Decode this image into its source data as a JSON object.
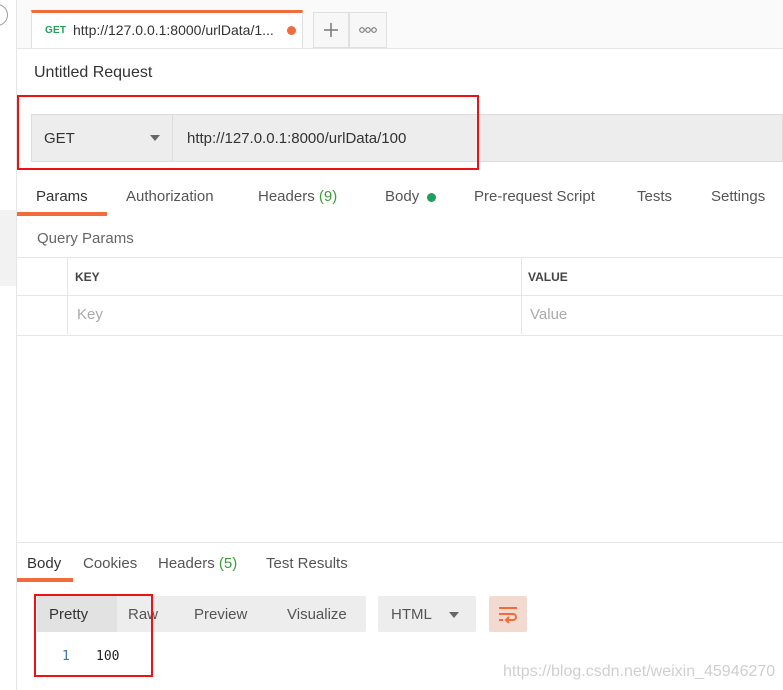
{
  "tab": {
    "method": "GET",
    "title": "http://127.0.0.1:8000/urlData/1...",
    "new_tab_symbol": "+",
    "more_symbol": "◦◦◦"
  },
  "request": {
    "title": "Untitled Request",
    "method": "GET",
    "url": "http://127.0.0.1:8000/urlData/100"
  },
  "request_tabs": [
    {
      "label": "Params"
    },
    {
      "label": "Authorization"
    },
    {
      "label": "Headers",
      "count": "(9)"
    },
    {
      "label": "Body"
    },
    {
      "label": "Pre-request Script"
    },
    {
      "label": "Tests"
    },
    {
      "label": "Settings"
    }
  ],
  "query_params": {
    "title": "Query Params",
    "key_header": "KEY",
    "value_header": "VALUE",
    "key_placeholder": "Key",
    "value_placeholder": "Value"
  },
  "response_tabs": [
    {
      "label": "Body"
    },
    {
      "label": "Cookies"
    },
    {
      "label": "Headers",
      "count": "(5)"
    },
    {
      "label": "Test Results"
    }
  ],
  "response_view": {
    "modes": [
      "Pretty",
      "Raw",
      "Preview",
      "Visualize"
    ],
    "format": "HTML"
  },
  "response_body": {
    "line_number": "1",
    "value": "100"
  },
  "watermark": "https://blog.csdn.net/weixin_45946270",
  "colors": {
    "accent": "#f26b3a",
    "method_get": "#1f9f5a",
    "highlight": "#ee1111",
    "count": "#3a9d3a"
  }
}
